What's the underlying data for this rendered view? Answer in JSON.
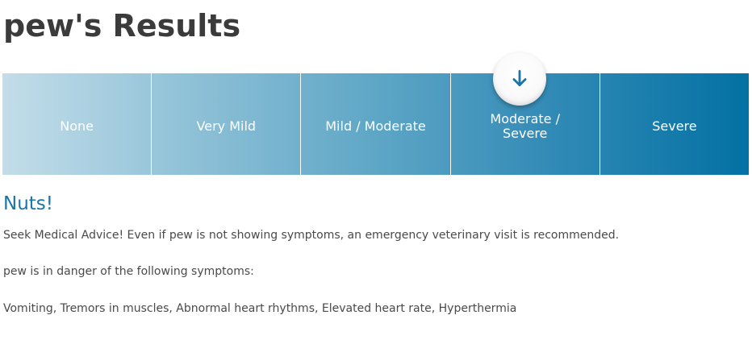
{
  "header": {
    "title": "pew's Results"
  },
  "severity_scale": {
    "levels": [
      {
        "label": "None"
      },
      {
        "label": "Very Mild"
      },
      {
        "label": "Mild / Moderate"
      },
      {
        "label": "Moderate / Severe"
      },
      {
        "label": "Severe"
      }
    ],
    "selected_index": 3,
    "marker_icon": "arrow-down-icon",
    "marker_color": "#1a75a8",
    "gradient_start_color": "#c3dde9",
    "gradient_end_color": "#0371a3"
  },
  "result": {
    "heading": "Nuts!",
    "advice": "Seek Medical Advice! Even if pew is not showing symptoms, an emergency veterinary visit is recommended.",
    "symptoms_intro": "pew is in danger of the following symptoms:",
    "symptoms_list": "Vomiting, Tremors in muscles, Abnormal heart rhythms, Elevated heart rate, Hyperthermia"
  }
}
